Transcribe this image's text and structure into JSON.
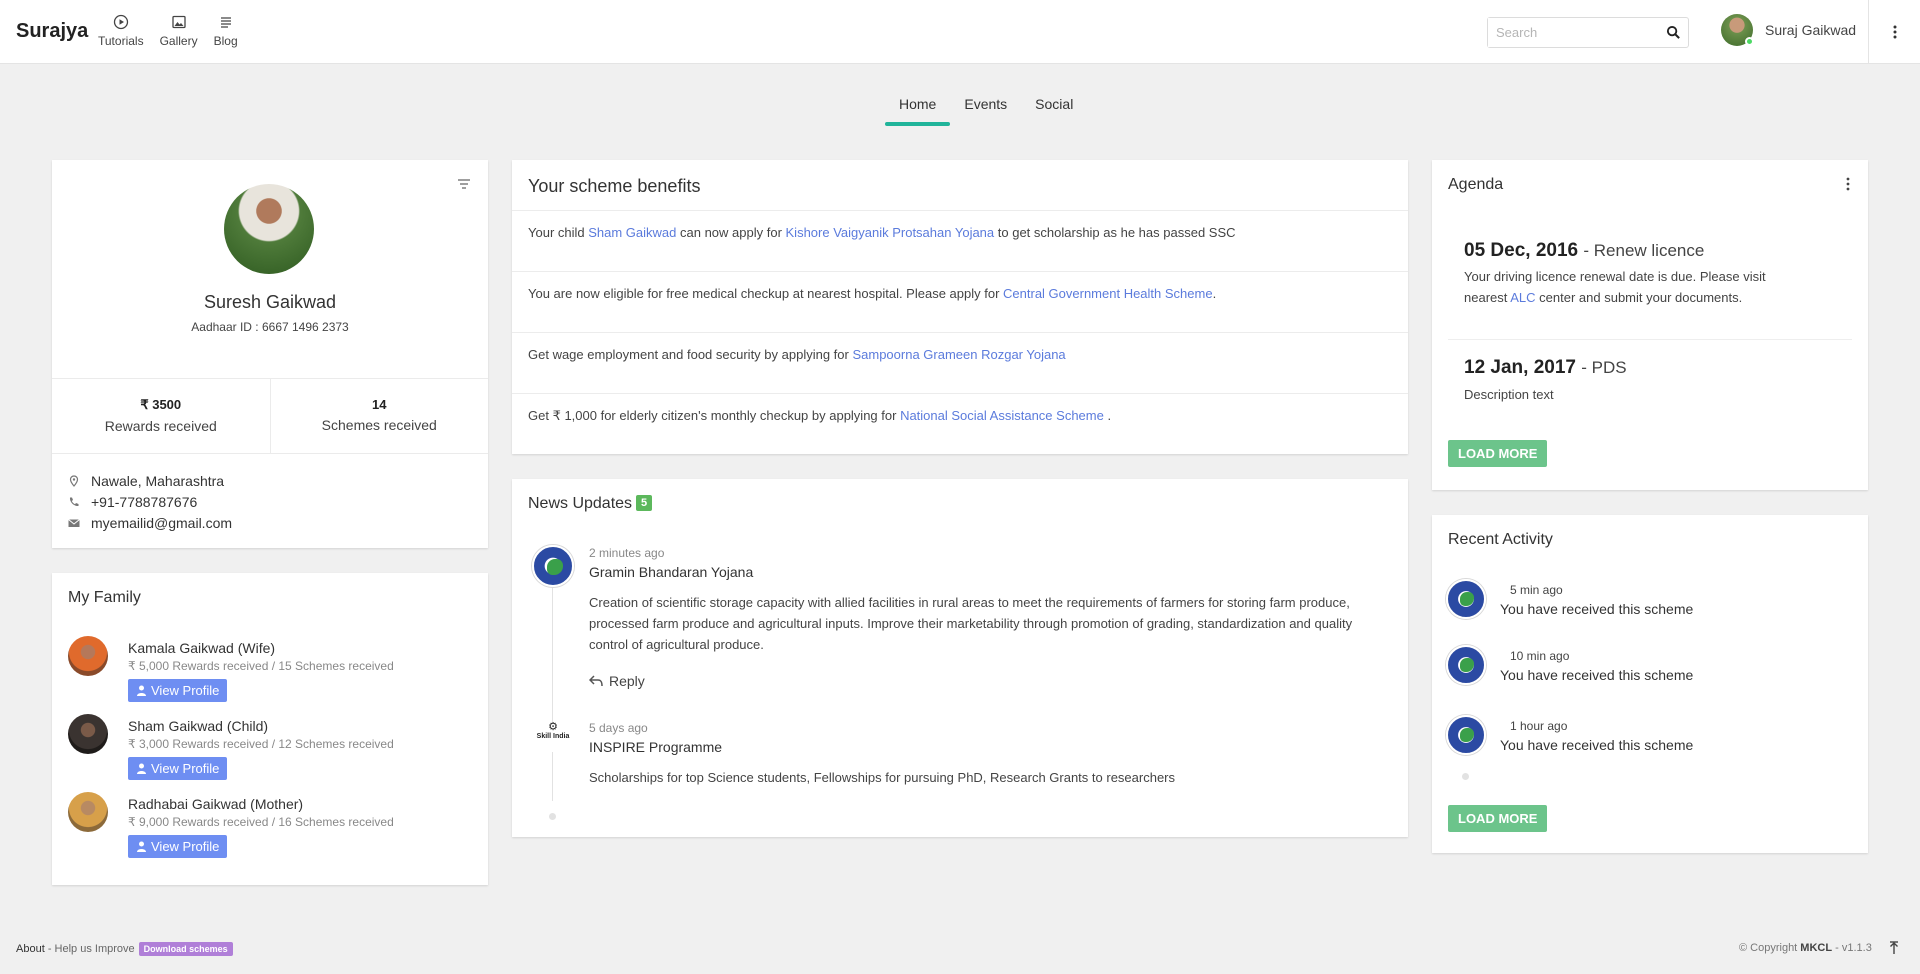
{
  "nav": {
    "brand": "Surajya",
    "links": [
      {
        "label": "Tutorials",
        "icon": "play-circle-icon"
      },
      {
        "label": "Gallery",
        "icon": "image-icon"
      },
      {
        "label": "Blog",
        "icon": "list-icon"
      }
    ],
    "search_placeholder": "Search",
    "user_name": "Suraj Gaikwad"
  },
  "tabs": [
    "Home",
    "Events",
    "Social"
  ],
  "active_tab": "Home",
  "profile": {
    "name": "Suresh Gaikwad",
    "aadhaar": "Aadhaar ID : 6667 1496 2373",
    "rewards_value": "₹ 3500",
    "rewards_label": "Rewards received",
    "schemes_value": "14",
    "schemes_label": "Schemes received",
    "location": "Nawale, Maharashtra",
    "phone": "+91-7788787676",
    "email": "myemailid@gmail.com"
  },
  "family": {
    "title": "My Family",
    "members": [
      {
        "name": "Kamala Gaikwad (Wife)",
        "summary": "₹ 5,000 Rewards received / 15 Schemes received"
      },
      {
        "name": "Sham Gaikwad (Child)",
        "summary": "₹ 3,000 Rewards received / 12 Schemes received"
      },
      {
        "name": "Radhabai Gaikwad (Mother)",
        "summary": "₹ 9,000 Rewards received / 16 Schemes received"
      }
    ],
    "button_label": "View Profile"
  },
  "benefits": {
    "title": "Your scheme benefits",
    "row1": {
      "t1": "Your child ",
      "l1": "Sham Gaikwad",
      "t2": " can now apply for ",
      "l2": "Kishore Vaigyanik Protsahan Yojana",
      "t3": " to get scholarship as he has passed SSC"
    },
    "row2": {
      "t1": "You are now eligible for free medical checkup at nearest hospital. Please apply for ",
      "l1": "Central Government Health Scheme",
      "t2": "."
    },
    "row3": {
      "t1": "Get wage employment and food security by applying for ",
      "l1": "Sampoorna Grameen Rozgar Yojana"
    },
    "row4": {
      "t1": "Get ₹ 1,000 for elderly citizen's monthly checkup by applying for ",
      "l1": "National Social Assistance Scheme",
      "t2": " ."
    }
  },
  "news": {
    "title": "News Updates",
    "count": "5",
    "items": [
      {
        "time": "2 minutes ago",
        "title": "Gramin Bhandaran Yojana",
        "body": "Creation of scientific storage capacity with allied facilities in rural areas to meet the requirements of farmers for storing farm produce, processed farm produce and agricultural inputs. Improve their marketability through promotion of grading, standardization and quality control of agricultural produce.",
        "reply": "Reply"
      },
      {
        "time": "5 days ago",
        "title": "INSPIRE Programme",
        "body": "Scholarships for top Science students, Fellowships for pursuing PhD, Research Grants to researchers",
        "logo_text": "Skill India"
      }
    ]
  },
  "agenda": {
    "title": "Agenda",
    "items": [
      {
        "date": "05 Dec, 2016",
        "event": "- Renew licence",
        "desc1": "Your driving licence renewal date is due. Please visit nearest ",
        "link": "ALC",
        "desc2": " center and submit your documents."
      },
      {
        "date": "12 Jan, 2017",
        "event": "- PDS",
        "desc1": "Description text"
      }
    ],
    "load_more": "LOAD MORE"
  },
  "recent": {
    "title": "Recent Activity",
    "items": [
      {
        "time": "5 min ago",
        "text": "You have received this scheme"
      },
      {
        "time": "10 min ago",
        "text": "You have received this scheme"
      },
      {
        "time": "1 hour ago",
        "text": "You have received this scheme"
      }
    ],
    "load_more": "LOAD MORE"
  },
  "footer": {
    "about": "About",
    "help": "- Help us Improve",
    "download": "Download schemes",
    "copyright_prefix": "© Copyright ",
    "org": "MKCL",
    "version": " - v1.1.3"
  },
  "colors": {
    "accent": "#20b49a",
    "link": "#5b7bdc",
    "button": "#6e8ef2",
    "load_more": "#6cc48b",
    "badge": "#5cb85c"
  }
}
